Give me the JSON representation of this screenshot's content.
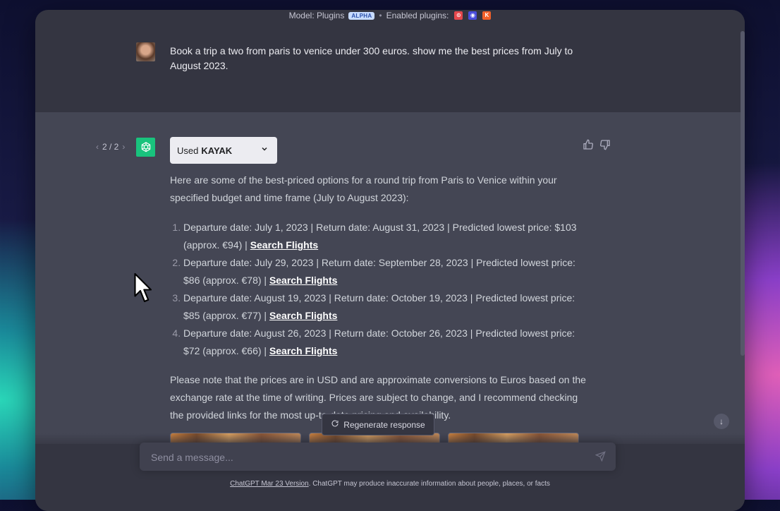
{
  "topbar": {
    "model_label": "Model: Plugins",
    "alpha_badge": "ALPHA",
    "separator": "•",
    "enabled_label": "Enabled plugins:"
  },
  "user_message": {
    "text": "Book a trip a two from paris to venice under 300 euros. show me the best prices from July to August 2023."
  },
  "assistant": {
    "pager": {
      "prev": "‹",
      "current": "2 / 2",
      "next": "›"
    },
    "plugin_used": {
      "prefix": "Used",
      "name": "KAYAK"
    },
    "intro": "Here are some of the best-priced options for a round trip from Paris to Venice within your specified budget and time frame (July to August 2023):",
    "options": [
      {
        "text": "Departure date: July 1, 2023 | Return date: August 31, 2023 | Predicted lowest price: $103 (approx. €94) | ",
        "link": "Search Flights"
      },
      {
        "text": "Departure date: July 29, 2023 | Return date: September 28, 2023 | Predicted lowest price: $86 (approx. €78) | ",
        "link": "Search Flights"
      },
      {
        "text": "Departure date: August 19, 2023 | Return date: October 19, 2023 | Predicted lowest price: $85 (approx. €77) | ",
        "link": "Search Flights"
      },
      {
        "text": "Departure date: August 26, 2023 | Return date: October 26, 2023 | Predicted lowest price: $72 (approx. €66) | ",
        "link": "Search Flights"
      }
    ],
    "note": "Please note that the prices are in USD and are approximate conversions to Euros based on the exchange rate at the time of writing. Prices are subject to change, and I recommend checking the provided links for the most up-to-date pricing and availability."
  },
  "regenerate_label": "Regenerate response",
  "composer": {
    "placeholder": "Send a message..."
  },
  "footer": {
    "link": "ChatGPT Mar 23 Version",
    "text": ". ChatGPT may produce inaccurate information about people, places, or facts"
  },
  "colors": {
    "window_bg": "#343541",
    "assistant_bg": "#444654",
    "gpt_green": "#19c37d"
  }
}
